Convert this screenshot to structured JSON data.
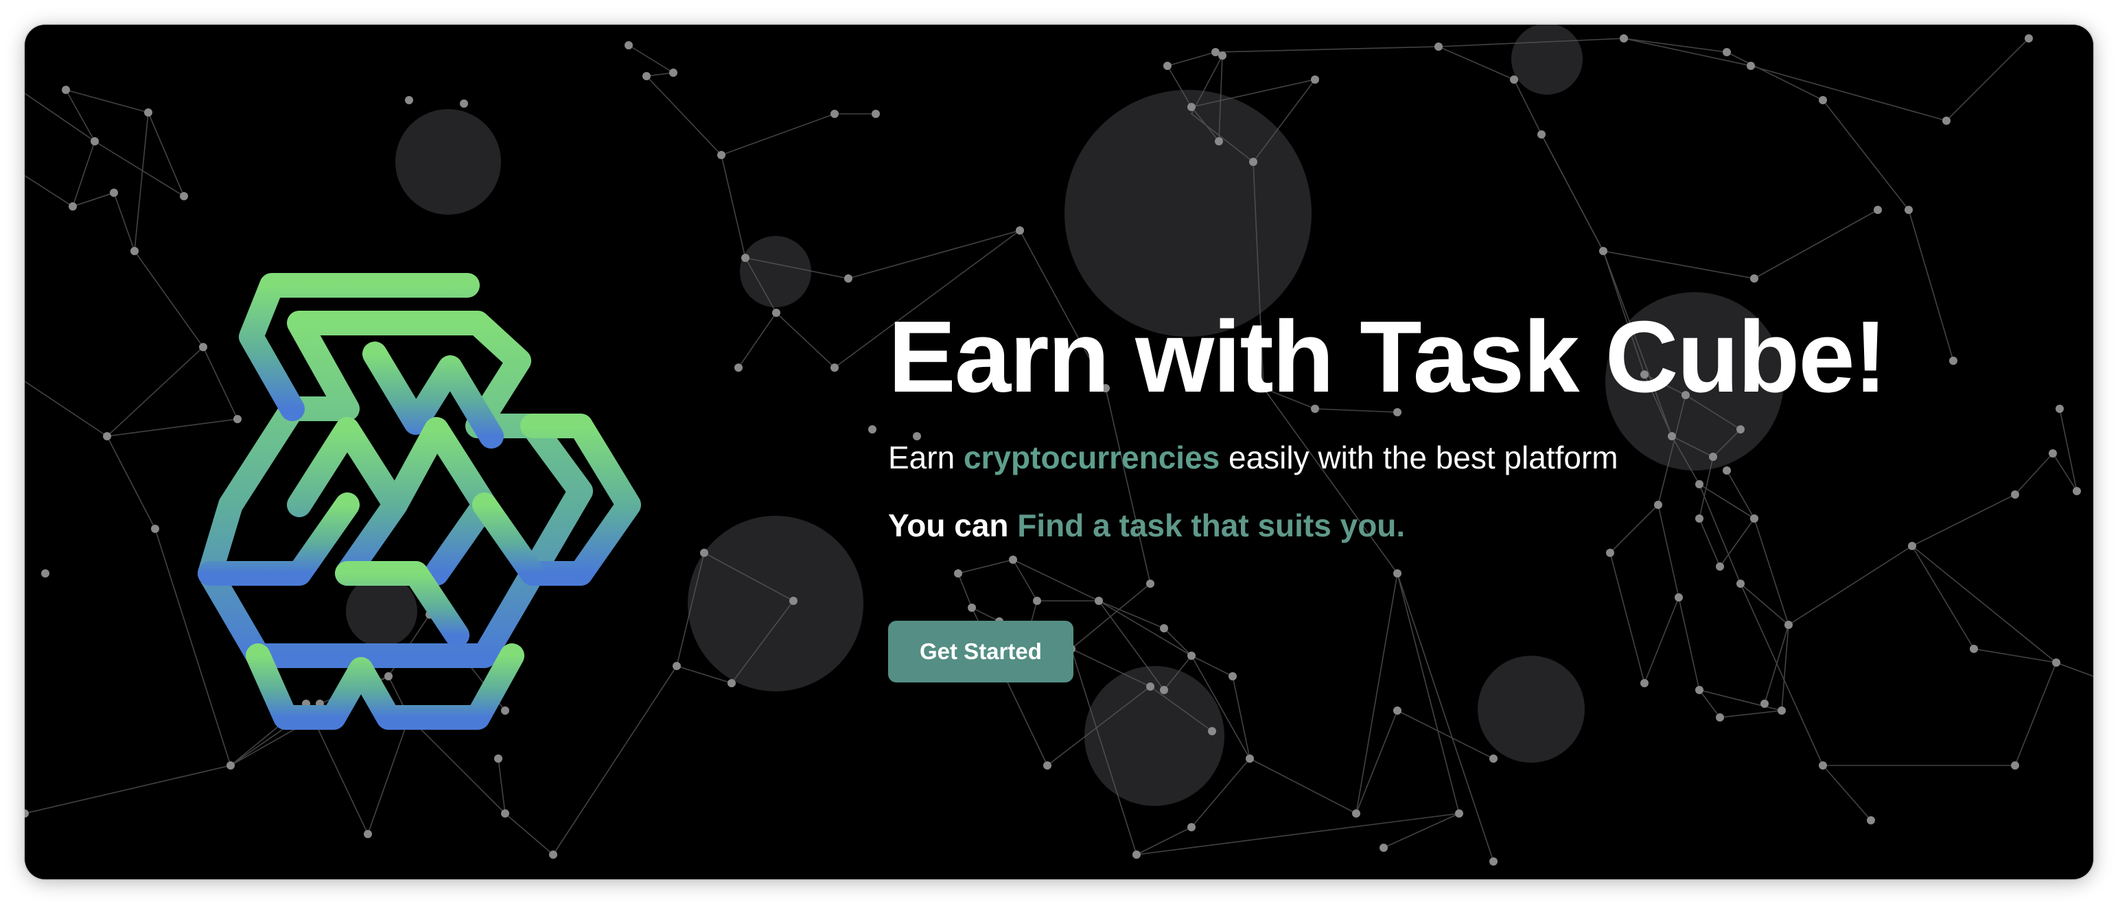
{
  "hero": {
    "title": "Earn with Task Cube!",
    "subtitle": {
      "before": "Earn ",
      "highlight": "cryptocurrencies",
      "after": " easily with the best platform"
    },
    "tagline": {
      "before": "You can ",
      "highlight": "Find a task that suits you."
    },
    "cta_label": "Get Started"
  },
  "logo": {
    "icon": "task-cube-logo-icon",
    "gradient_top": "#82dd79",
    "gradient_bottom": "#4a7bd6"
  },
  "colors": {
    "background": "#000000",
    "accent_text": "#5e9e8c",
    "button": "#548e84",
    "network_line": "#5a5a5a",
    "network_node": "#8a8a8a",
    "bubble": "#2a2a2e"
  }
}
